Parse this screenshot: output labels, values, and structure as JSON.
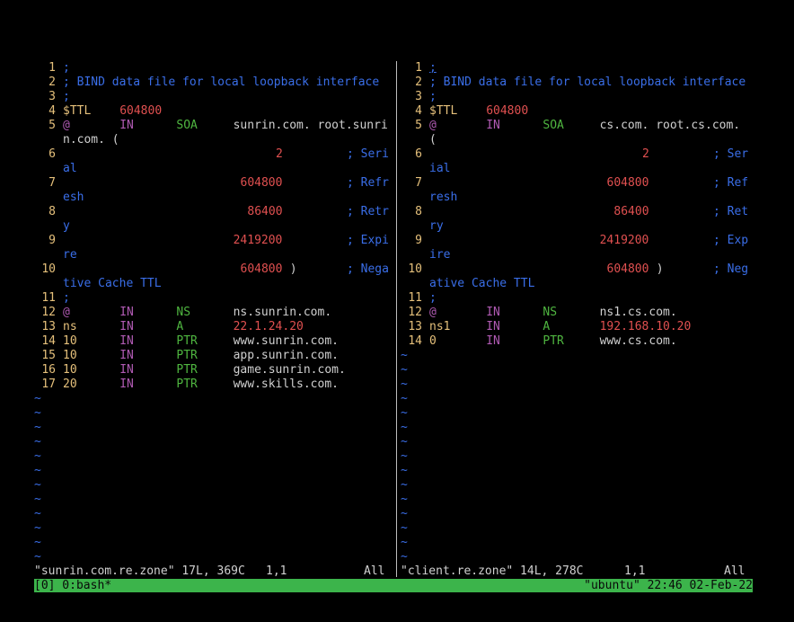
{
  "colors": {
    "line_number": "#e5c07b",
    "comment": "#3a6ee8",
    "keyword_in": "#b05ab3",
    "record_type": "#4fb640",
    "number": "#e05050",
    "name": "#e5c07b",
    "text": "#d0d0d0",
    "tilde": "#3a6ee8",
    "tmux_bg": "#3cb44b"
  },
  "left_pane": {
    "lines": [
      {
        "n": "1",
        "f": [
          {
            "c": 0,
            "t": ";",
            "k": "comment"
          }
        ]
      },
      {
        "n": "2",
        "f": [
          {
            "c": 0,
            "t": "; BIND data file for local loopback interface",
            "k": "comment"
          }
        ]
      },
      {
        "n": "3",
        "f": [
          {
            "c": 0,
            "t": ";",
            "k": "comment"
          }
        ]
      },
      {
        "n": "4",
        "f": [
          {
            "c": 0,
            "t": "$TTL",
            "k": "name"
          },
          {
            "c": 8,
            "t": "604800",
            "k": "number"
          }
        ]
      },
      {
        "n": "5",
        "f": [
          {
            "c": 0,
            "t": "@",
            "k": "keyword_in"
          },
          {
            "c": 8,
            "t": "IN",
            "k": "keyword_in"
          },
          {
            "c": 16,
            "t": "SOA",
            "k": "record_type"
          },
          {
            "c": 24,
            "t": "sunrin.com. root.sunri",
            "k": "text"
          }
        ]
      },
      {
        "n": "",
        "f": [
          {
            "c": 0,
            "t": "n.com. (",
            "k": "text"
          }
        ]
      },
      {
        "n": "6",
        "f": [
          {
            "c": 30,
            "t": "2",
            "k": "number"
          },
          {
            "c": 40,
            "t": "; Seri",
            "k": "comment"
          }
        ]
      },
      {
        "n": "",
        "f": [
          {
            "c": 0,
            "t": "al",
            "k": "comment"
          }
        ]
      },
      {
        "n": "7",
        "f": [
          {
            "c": 25,
            "t": "604800",
            "k": "number"
          },
          {
            "c": 40,
            "t": "; Refr",
            "k": "comment"
          }
        ]
      },
      {
        "n": "",
        "f": [
          {
            "c": 0,
            "t": "esh",
            "k": "comment"
          }
        ]
      },
      {
        "n": "8",
        "f": [
          {
            "c": 26,
            "t": "86400",
            "k": "number"
          },
          {
            "c": 40,
            "t": "; Retr",
            "k": "comment"
          }
        ]
      },
      {
        "n": "",
        "f": [
          {
            "c": 0,
            "t": "y",
            "k": "comment"
          }
        ]
      },
      {
        "n": "9",
        "f": [
          {
            "c": 24,
            "t": "2419200",
            "k": "number"
          },
          {
            "c": 40,
            "t": "; Expi",
            "k": "comment"
          }
        ]
      },
      {
        "n": "",
        "f": [
          {
            "c": 0,
            "t": "re",
            "k": "comment"
          }
        ]
      },
      {
        "n": "10",
        "f": [
          {
            "c": 25,
            "t": "604800",
            "k": "number"
          },
          {
            "c": 32,
            "t": ")",
            "k": "text"
          },
          {
            "c": 40,
            "t": "; Nega",
            "k": "comment"
          }
        ]
      },
      {
        "n": "",
        "f": [
          {
            "c": 0,
            "t": "tive Cache TTL",
            "k": "comment"
          }
        ]
      },
      {
        "n": "11",
        "f": [
          {
            "c": 0,
            "t": ";",
            "k": "comment"
          }
        ]
      },
      {
        "n": "12",
        "f": [
          {
            "c": 0,
            "t": "@",
            "k": "keyword_in"
          },
          {
            "c": 8,
            "t": "IN",
            "k": "keyword_in"
          },
          {
            "c": 16,
            "t": "NS",
            "k": "record_type"
          },
          {
            "c": 24,
            "t": "ns.sunrin.com.",
            "k": "text"
          }
        ]
      },
      {
        "n": "13",
        "f": [
          {
            "c": 0,
            "t": "ns",
            "k": "name"
          },
          {
            "c": 8,
            "t": "IN",
            "k": "keyword_in"
          },
          {
            "c": 16,
            "t": "A",
            "k": "record_type"
          },
          {
            "c": 24,
            "t": "22.1.24.20",
            "k": "number"
          }
        ]
      },
      {
        "n": "14",
        "f": [
          {
            "c": 0,
            "t": "10",
            "k": "name"
          },
          {
            "c": 8,
            "t": "IN",
            "k": "keyword_in"
          },
          {
            "c": 16,
            "t": "PTR",
            "k": "record_type"
          },
          {
            "c": 24,
            "t": "www.sunrin.com.",
            "k": "text"
          }
        ]
      },
      {
        "n": "15",
        "f": [
          {
            "c": 0,
            "t": "10",
            "k": "name"
          },
          {
            "c": 8,
            "t": "IN",
            "k": "keyword_in"
          },
          {
            "c": 16,
            "t": "PTR",
            "k": "record_type"
          },
          {
            "c": 24,
            "t": "app.sunrin.com.",
            "k": "text"
          }
        ]
      },
      {
        "n": "16",
        "f": [
          {
            "c": 0,
            "t": "10",
            "k": "name"
          },
          {
            "c": 8,
            "t": "IN",
            "k": "keyword_in"
          },
          {
            "c": 16,
            "t": "PTR",
            "k": "record_type"
          },
          {
            "c": 24,
            "t": "game.sunrin.com.",
            "k": "text"
          }
        ]
      },
      {
        "n": "17",
        "f": [
          {
            "c": 0,
            "t": "20",
            "k": "name"
          },
          {
            "c": 8,
            "t": "IN",
            "k": "keyword_in"
          },
          {
            "c": 16,
            "t": "PTR",
            "k": "record_type"
          },
          {
            "c": 24,
            "t": "www.skills.com.",
            "k": "text"
          }
        ]
      }
    ],
    "tilde_rows": [
      "~",
      "~",
      "~",
      "~",
      "~",
      "~",
      "~",
      "~",
      "~",
      "~",
      "~",
      "~",
      "~"
    ],
    "status": {
      "file": "\"sunrin.com.re.zone\" 17L, 369C",
      "position": "1,1",
      "scroll": "All"
    }
  },
  "right_pane": {
    "lines": [
      {
        "n": "1",
        "f": [
          {
            "c": 0,
            "t": ";",
            "k": "comment",
            "cursor": true
          }
        ]
      },
      {
        "n": "2",
        "f": [
          {
            "c": 0,
            "t": "; BIND data file for local loopback interface",
            "k": "comment"
          }
        ]
      },
      {
        "n": "3",
        "f": [
          {
            "c": 0,
            "t": ";",
            "k": "comment"
          }
        ]
      },
      {
        "n": "4",
        "f": [
          {
            "c": 0,
            "t": "$TTL",
            "k": "name"
          },
          {
            "c": 8,
            "t": "604800",
            "k": "number"
          }
        ]
      },
      {
        "n": "5",
        "f": [
          {
            "c": 0,
            "t": "@",
            "k": "keyword_in"
          },
          {
            "c": 8,
            "t": "IN",
            "k": "keyword_in"
          },
          {
            "c": 16,
            "t": "SOA",
            "k": "record_type"
          },
          {
            "c": 24,
            "t": "cs.com. root.cs.com.",
            "k": "text"
          }
        ]
      },
      {
        "n": "",
        "f": [
          {
            "c": 0,
            "t": "(",
            "k": "text"
          }
        ]
      },
      {
        "n": "6",
        "f": [
          {
            "c": 30,
            "t": "2",
            "k": "number"
          },
          {
            "c": 40,
            "t": "; Ser",
            "k": "comment"
          }
        ]
      },
      {
        "n": "",
        "f": [
          {
            "c": 0,
            "t": "ial",
            "k": "comment"
          }
        ]
      },
      {
        "n": "7",
        "f": [
          {
            "c": 25,
            "t": "604800",
            "k": "number"
          },
          {
            "c": 40,
            "t": "; Ref",
            "k": "comment"
          }
        ]
      },
      {
        "n": "",
        "f": [
          {
            "c": 0,
            "t": "resh",
            "k": "comment"
          }
        ]
      },
      {
        "n": "8",
        "f": [
          {
            "c": 26,
            "t": "86400",
            "k": "number"
          },
          {
            "c": 40,
            "t": "; Ret",
            "k": "comment"
          }
        ]
      },
      {
        "n": "",
        "f": [
          {
            "c": 0,
            "t": "ry",
            "k": "comment"
          }
        ]
      },
      {
        "n": "9",
        "f": [
          {
            "c": 24,
            "t": "2419200",
            "k": "number"
          },
          {
            "c": 40,
            "t": "; Exp",
            "k": "comment"
          }
        ]
      },
      {
        "n": "",
        "f": [
          {
            "c": 0,
            "t": "ire",
            "k": "comment"
          }
        ]
      },
      {
        "n": "10",
        "f": [
          {
            "c": 25,
            "t": "604800",
            "k": "number"
          },
          {
            "c": 32,
            "t": ")",
            "k": "text"
          },
          {
            "c": 40,
            "t": "; Neg",
            "k": "comment"
          }
        ]
      },
      {
        "n": "",
        "f": [
          {
            "c": 0,
            "t": "ative Cache TTL",
            "k": "comment"
          }
        ]
      },
      {
        "n": "11",
        "f": [
          {
            "c": 0,
            "t": ";",
            "k": "comment"
          }
        ]
      },
      {
        "n": "12",
        "f": [
          {
            "c": 0,
            "t": "@",
            "k": "keyword_in"
          },
          {
            "c": 8,
            "t": "IN",
            "k": "keyword_in"
          },
          {
            "c": 16,
            "t": "NS",
            "k": "record_type"
          },
          {
            "c": 24,
            "t": "ns1.cs.com.",
            "k": "text"
          }
        ]
      },
      {
        "n": "13",
        "f": [
          {
            "c": 0,
            "t": "ns1",
            "k": "name"
          },
          {
            "c": 8,
            "t": "IN",
            "k": "keyword_in"
          },
          {
            "c": 16,
            "t": "A",
            "k": "record_type"
          },
          {
            "c": 24,
            "t": "192.168.10.20",
            "k": "number"
          }
        ]
      },
      {
        "n": "14",
        "f": [
          {
            "c": 0,
            "t": "0",
            "k": "name"
          },
          {
            "c": 8,
            "t": "IN",
            "k": "keyword_in"
          },
          {
            "c": 16,
            "t": "PTR",
            "k": "record_type"
          },
          {
            "c": 24,
            "t": "www.cs.com.",
            "k": "text"
          }
        ]
      }
    ],
    "tilde_rows": [
      "~",
      "~",
      "~",
      "~",
      "~",
      "~",
      "~",
      "~",
      "~",
      "~",
      "~",
      "~",
      "~",
      "~",
      "~",
      "~"
    ],
    "status": {
      "file": "\"client.re.zone\" 14L, 278C",
      "position": "1,1",
      "scroll": "All"
    }
  },
  "tmux": {
    "session": "[0] 0:bash*",
    "host": "\"ubuntu\" 22:46 02-Feb-22"
  }
}
